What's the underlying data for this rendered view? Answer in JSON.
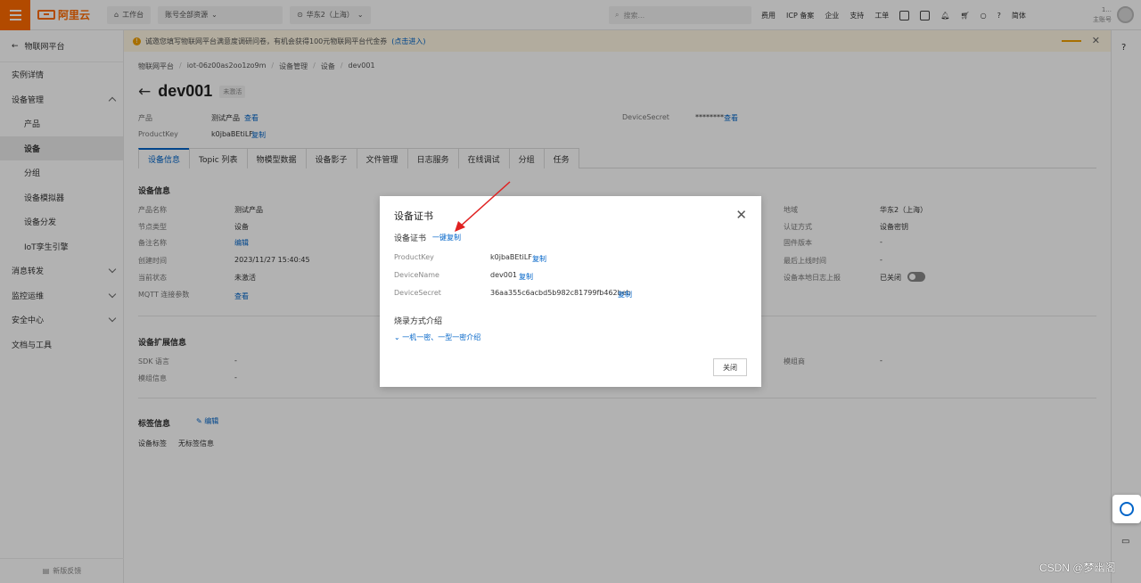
{
  "topbar": {
    "logo_text": "阿里云",
    "workbench": "工作台",
    "account_switch": "账号全部资源",
    "region": "华东2（上海）",
    "search_placeholder": "搜索...",
    "nav": [
      "费用",
      "ICP 备案",
      "企业",
      "支持",
      "工单"
    ],
    "lang": "简体",
    "account_role": "主账号",
    "account_name": "1..."
  },
  "sidebar": {
    "back_label": "物联网平台",
    "items": [
      {
        "label": "实例详情"
      },
      {
        "label": "设备管理"
      },
      {
        "label": "产品"
      },
      {
        "label": "设备"
      },
      {
        "label": "分组"
      },
      {
        "label": "设备模拟器"
      },
      {
        "label": "设备分发"
      },
      {
        "label": "IoT孪生引擎"
      },
      {
        "label": "消息转发"
      },
      {
        "label": "监控运维"
      },
      {
        "label": "安全中心"
      },
      {
        "label": "文档与工具"
      }
    ],
    "feedback": "新版反馈"
  },
  "banner": {
    "text": "诚邀您填写物联网平台满意度调研问卷，有机会获得100元物联网平台代金券",
    "link": "(点击进入)"
  },
  "breadcrumb": [
    "物联网平台",
    "iot-06z00as2oo1zo9m",
    "设备管理",
    "设备",
    "dev001"
  ],
  "device": {
    "name": "dev001",
    "status_badge": "未激活",
    "product_label": "产品",
    "product_value": "测试产品",
    "view_link": "查看",
    "productkey_label": "ProductKey",
    "productkey_value": "k0jbaBEtiLF",
    "copy_link": "复制",
    "secret_label": "DeviceSecret",
    "secret_value": "********"
  },
  "tabs": [
    "设备信息",
    "Topic 列表",
    "物模型数据",
    "设备影子",
    "文件管理",
    "日志服务",
    "在线调试",
    "分组",
    "任务"
  ],
  "device_info": {
    "section_title": "设备信息",
    "left": [
      {
        "k": "产品名称",
        "v": "测试产品"
      },
      {
        "k": "节点类型",
        "v": "设备"
      },
      {
        "k": "备注名称",
        "v": "编辑"
      },
      {
        "k": "创建时间",
        "v": "2023/11/27 15:40:45"
      },
      {
        "k": "当前状态",
        "v": "未激活"
      },
      {
        "k": "MQTT 连接参数",
        "v": "查看"
      }
    ],
    "right": [
      {
        "k": "地域",
        "v": "华东2（上海）"
      },
      {
        "k": "认证方式",
        "v": "设备密钥"
      },
      {
        "k": "固件版本",
        "v": "-"
      },
      {
        "k": "最后上线时间",
        "v": "-"
      },
      {
        "k": "设备本地日志上报",
        "v": "已关闭"
      }
    ]
  },
  "ext_info": {
    "section_title": "设备扩展信息",
    "rows": [
      {
        "k": "SDK 语言",
        "v": "-"
      },
      {
        "k": "模组信息",
        "v": "-"
      }
    ],
    "right": [
      {
        "k": "模组商",
        "v": "-"
      }
    ]
  },
  "tags": {
    "section_title": "标签信息",
    "edit": "编辑",
    "label": "设备标签",
    "value": "无标签信息"
  },
  "dialog": {
    "title": "设备证书",
    "cert_label": "设备证书",
    "copy_all": "一键复制",
    "fields": [
      {
        "k": "ProductKey",
        "v": "k0jbaBEtiLF"
      },
      {
        "k": "DeviceName",
        "v": "dev001"
      },
      {
        "k": "DeviceSecret",
        "v": "36aa355c6acbd5b982c81799fb462beb"
      }
    ],
    "copy": "复制",
    "burn_title": "烧录方式介绍",
    "burn_link": "一机一密、一型一密介绍",
    "close_btn": "关闭"
  },
  "watermark": "CSDN @梦幽阁",
  "colors": {
    "accent": "#ff6a00",
    "link": "#0064c8"
  }
}
